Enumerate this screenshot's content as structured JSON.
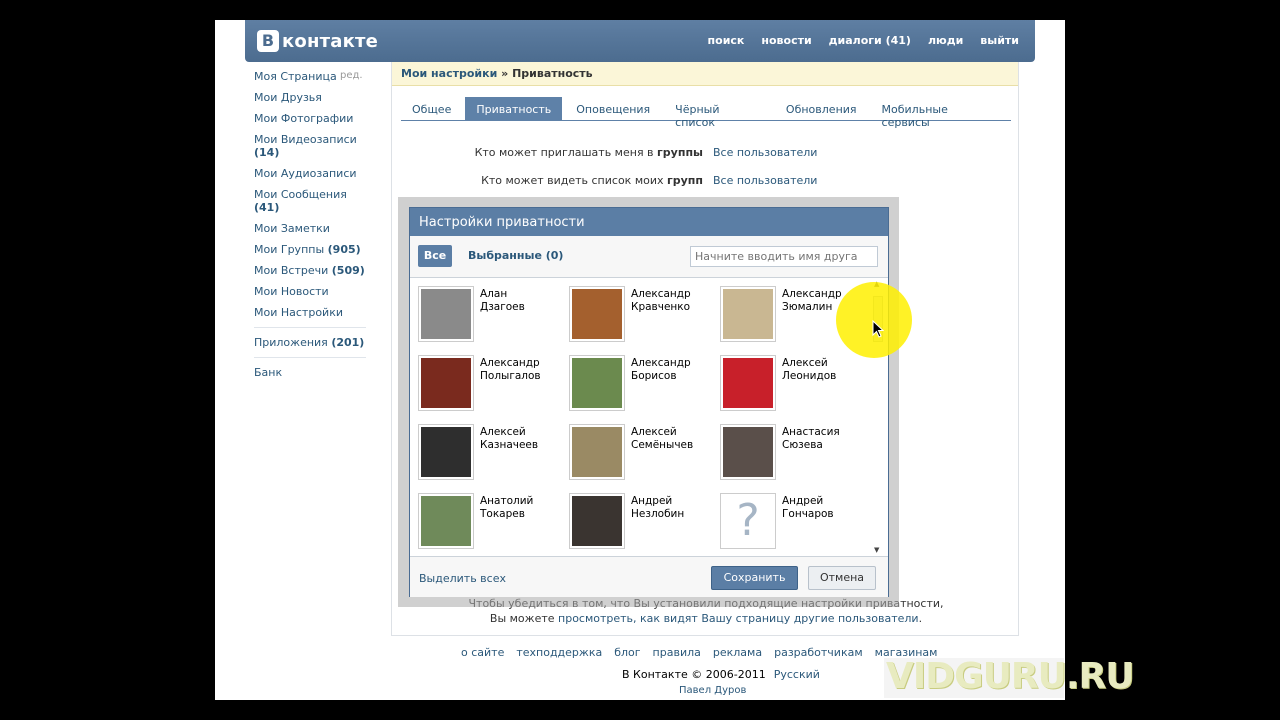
{
  "header": {
    "logo_letter": "B",
    "logo_text": "контакте",
    "nav": [
      "поиск",
      "новости",
      "диалоги (41)",
      "люди",
      "выйти"
    ]
  },
  "sidebar": {
    "edit_label": "ред.",
    "items": [
      {
        "label": "Моя Страница",
        "count": ""
      },
      {
        "label": "Мои Друзья",
        "count": ""
      },
      {
        "label": "Мои Фотографии",
        "count": ""
      },
      {
        "label": "Мои Видеозаписи",
        "count": "(14)"
      },
      {
        "label": "Мои Аудиозаписи",
        "count": ""
      },
      {
        "label": "Мои Сообщения",
        "count": "(41)"
      },
      {
        "label": "Мои Заметки",
        "count": ""
      },
      {
        "label": "Мои Группы",
        "count": "(905)"
      },
      {
        "label": "Мои Встречи",
        "count": "(509)"
      },
      {
        "label": "Мои Новости",
        "count": ""
      },
      {
        "label": "Мои Настройки",
        "count": ""
      }
    ],
    "apps_label": "Приложения",
    "apps_count": "(201)",
    "bank_label": "Банк"
  },
  "breadcrumb": {
    "parent": "Мои настройки",
    "separator": "»",
    "current": "Приватность"
  },
  "tabs": [
    "Общее",
    "Приватность",
    "Оповещения",
    "Чёрный список",
    "Обновления",
    "Мобильные сервисы"
  ],
  "settings": [
    {
      "label_pre": "Кто может приглашать меня в ",
      "label_bold": "группы",
      "value": "Все пользователи"
    },
    {
      "label_pre": "Кто может видеть список моих ",
      "label_bold": "групп",
      "value": "Все пользователи"
    }
  ],
  "note": {
    "line1": "Чтобы убедиться в том, что Вы установили подходящие настройки приватности,",
    "line2_pre": "Вы можете ",
    "line2_link": "просмотреть, как видят Вашу страницу другие пользователи",
    "line2_post": "."
  },
  "popup": {
    "title": "Настройки приватности",
    "filter_all": "Все",
    "filter_selected": "Выбранные (0)",
    "search_placeholder": "Начните вводить имя друга",
    "friends": [
      {
        "first": "Алан",
        "last": "Дзагоев",
        "color": "#8a8a8a"
      },
      {
        "first": "Александр",
        "last": "Кравченко",
        "color": "#a4602e"
      },
      {
        "first": "Александр",
        "last": "Зюмалин",
        "color": "#c9b792"
      },
      {
        "first": "Александр",
        "last": "Полыгалов",
        "color": "#7a2a1e"
      },
      {
        "first": "Александр",
        "last": "Борисов",
        "color": "#6b8a4e"
      },
      {
        "first": "Алексей",
        "last": "Леонидов",
        "color": "#c8202a"
      },
      {
        "first": "Алексей",
        "last": "Казначеев",
        "color": "#2e2e2e"
      },
      {
        "first": "Алексей",
        "last": "Семёнычев",
        "color": "#9a8a64"
      },
      {
        "first": "Анастасия",
        "last": "Сюзева",
        "color": "#5a4f4a"
      },
      {
        "first": "Анатолий",
        "last": "Токарев",
        "color": "#6f8a5a"
      },
      {
        "first": "Андрей",
        "last": "Незлобин",
        "color": "#3a3430"
      },
      {
        "first": "Андрей",
        "last": "Гончаров",
        "color": "#ffffff",
        "placeholder": "?"
      }
    ],
    "select_all": "Выделить всех",
    "save": "Сохранить",
    "cancel": "Отмена"
  },
  "footer": {
    "links": [
      "о сайте",
      "техподдержка",
      "блог",
      "правила",
      "реклама",
      "разработчикам",
      "магазинам"
    ],
    "copyright": "В Контакте © 2006-2011",
    "language": "Русский",
    "author": "Павел Дуров"
  },
  "watermark": "VIDGURU.RU"
}
